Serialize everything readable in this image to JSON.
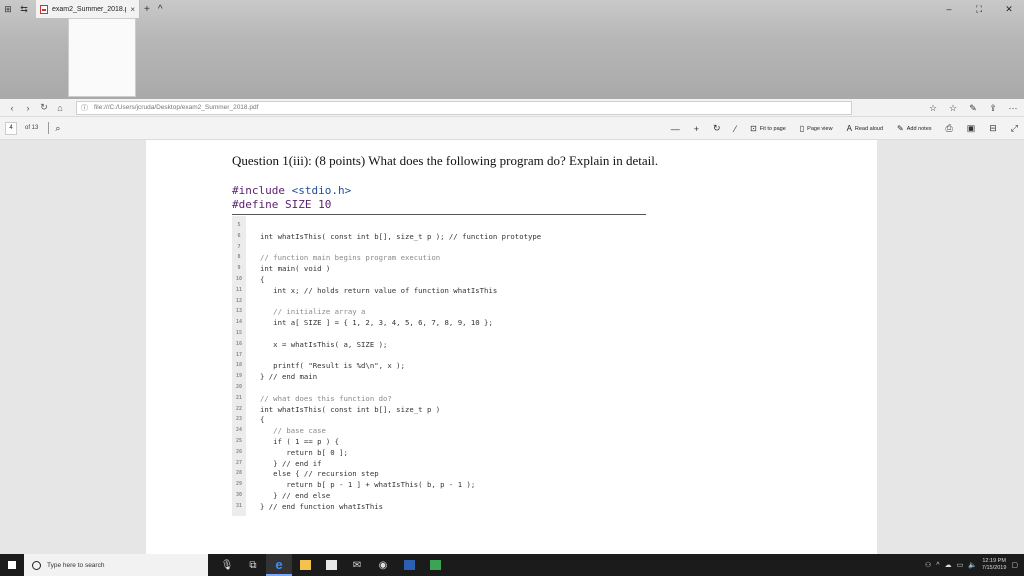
{
  "browser": {
    "tab_title": "exam2_Summer_2018.p",
    "tab_close": "×",
    "new_tab": "+",
    "tab_chevron": "^",
    "window_controls": [
      "–",
      "⛶",
      "✕"
    ],
    "url": "file:///C:/Users/jcruda/Desktop/exam2_Summer_2018.pdf",
    "nav_icons": [
      "back-icon",
      "forward-icon",
      "refresh-icon",
      "home-icon"
    ],
    "right_icons": [
      "star-icon",
      "favorites-icon",
      "pen-icon",
      "share-icon",
      "more-icon"
    ]
  },
  "pdf_toolbar": {
    "page_number": "4",
    "of_pages": "of 13",
    "zoom_out": "—",
    "zoom_in": "+",
    "fit_to_page": "Fit to page",
    "page_view": "Page view",
    "read_aloud": "Read aloud",
    "add_notes": "Add notes"
  },
  "document": {
    "question": "Question 1(iii): (8 points) What does the following program do? Explain in detail.",
    "include_kw": "#include ",
    "include_hdr": "<stdio.h>",
    "define_line": "#define SIZE 10",
    "code_lines": [
      {
        "n": "5",
        "t": "",
        "c": false
      },
      {
        "n": "6",
        "t": "int whatIsThis( const int b[], size_t p ); // function prototype",
        "c": false
      },
      {
        "n": "7",
        "t": "",
        "c": false
      },
      {
        "n": "8",
        "t": "// function main begins program execution",
        "c": true
      },
      {
        "n": "9",
        "t": "int main( void )",
        "c": false
      },
      {
        "n": "10",
        "t": "{",
        "c": false
      },
      {
        "n": "11",
        "t": "   int x; // holds return value of function whatIsThis",
        "c": false
      },
      {
        "n": "12",
        "t": "",
        "c": false
      },
      {
        "n": "13",
        "t": "   // initialize array a",
        "c": true
      },
      {
        "n": "14",
        "t": "   int a[ SIZE ] = { 1, 2, 3, 4, 5, 6, 7, 8, 9, 10 };",
        "c": false
      },
      {
        "n": "15",
        "t": "",
        "c": false
      },
      {
        "n": "16",
        "t": "   x = whatIsThis( a, SIZE );",
        "c": false
      },
      {
        "n": "17",
        "t": "",
        "c": false
      },
      {
        "n": "18",
        "t": "   printf( \"Result is %d\\n\", x );",
        "c": false
      },
      {
        "n": "19",
        "t": "} // end main",
        "c": false
      },
      {
        "n": "20",
        "t": "",
        "c": false
      },
      {
        "n": "21",
        "t": "// what does this function do?",
        "c": true
      },
      {
        "n": "22",
        "t": "int whatIsThis( const int b[], size_t p )",
        "c": false
      },
      {
        "n": "23",
        "t": "{",
        "c": false
      },
      {
        "n": "24",
        "t": "   // base case",
        "c": true
      },
      {
        "n": "25",
        "t": "   if ( 1 == p ) {",
        "c": false
      },
      {
        "n": "26",
        "t": "      return b[ 0 ];",
        "c": false
      },
      {
        "n": "27",
        "t": "   } // end if",
        "c": false
      },
      {
        "n": "28",
        "t": "   else { // recursion step",
        "c": false
      },
      {
        "n": "29",
        "t": "      return b[ p - 1 ] + whatIsThis( b, p - 1 );",
        "c": false
      },
      {
        "n": "30",
        "t": "   } // end else",
        "c": false
      },
      {
        "n": "31",
        "t": "} // end function whatIsThis",
        "c": false
      }
    ]
  },
  "taskbar": {
    "search_placeholder": "Type here to search",
    "time": "12:19 PM",
    "date": "7/15/2019"
  }
}
